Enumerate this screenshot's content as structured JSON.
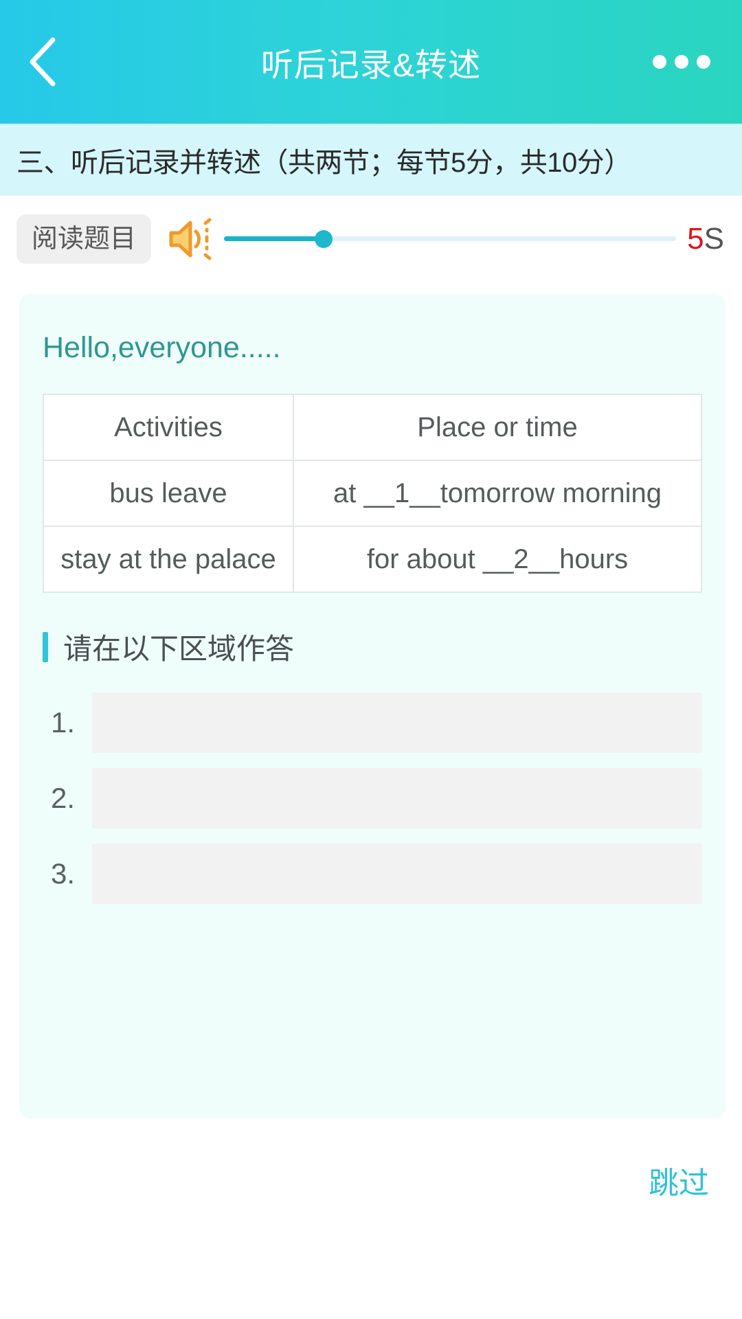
{
  "header": {
    "title": "听后记录&转述",
    "back_icon": "chevron-left-icon",
    "more_icon": "more-horizontal-icon"
  },
  "section": {
    "text": "三、听后记录并转述（共两节；每节5分，共10分）"
  },
  "audio": {
    "read_button_label": "阅读题目",
    "speaker_icon": "volume-speaker-icon",
    "progress_percent": 22,
    "timer_value": "5",
    "timer_unit": "S",
    "timer_value_color": "#e1131e"
  },
  "passage": {
    "intro": "Hello,everyone....."
  },
  "table": {
    "headers": [
      "Activities",
      "Place or time"
    ],
    "rows": [
      [
        "bus leave",
        "at __1__tomorrow morning"
      ],
      [
        "stay at the palace",
        "for about __2__hours"
      ]
    ]
  },
  "answer_section": {
    "heading": "请在以下区域作答",
    "items": [
      {
        "label": "1.",
        "value": ""
      },
      {
        "label": "2.",
        "value": ""
      },
      {
        "label": "3.",
        "value": ""
      }
    ]
  },
  "footer": {
    "skip_label": "跳过"
  },
  "theme": {
    "header_gradient_start": "#26c9e8",
    "header_gradient_end": "#2ad5c0",
    "banner_bg": "#d5f6fa",
    "card_bg": "#effdfb",
    "accent": "#2ec6d8",
    "passage_text": "#2f9790",
    "speaker_orange": "#f09a2c"
  }
}
